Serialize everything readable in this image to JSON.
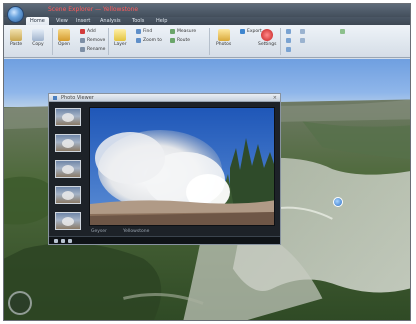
{
  "window": {
    "title": "Scene Explorer — Yellowstone"
  },
  "ribbon_tabs": [
    {
      "label": "Home"
    },
    {
      "label": "View"
    },
    {
      "label": "Insert"
    },
    {
      "label": "Analysis"
    },
    {
      "label": "Tools"
    },
    {
      "label": "Help"
    }
  ],
  "ribbon": {
    "buttons": [
      {
        "label": "Paste"
      },
      {
        "label": "Copy"
      },
      {
        "label": "Open"
      },
      {
        "label": "Layer"
      },
      {
        "label": "Photos"
      },
      {
        "label": "Settings"
      }
    ],
    "small_items": [
      {
        "label": "Add"
      },
      {
        "label": "Remove"
      },
      {
        "label": "Rename"
      },
      {
        "label": "Find"
      },
      {
        "label": "Zoom to"
      },
      {
        "label": "Measure"
      },
      {
        "label": "Route"
      },
      {
        "label": "Export"
      }
    ]
  },
  "photo_viewer": {
    "title": "Photo Viewer",
    "close_glyph": "×",
    "caption_left": "Geyser",
    "caption_right": "Yellowstone"
  },
  "colors": {
    "accent": "#4a7fc0",
    "title_text": "#ff5a5a",
    "dialog_bg": "#1d2228"
  },
  "icons": {
    "app": "globe-icon",
    "placemark": "placemark-icon",
    "navigation": "compass-icon"
  }
}
